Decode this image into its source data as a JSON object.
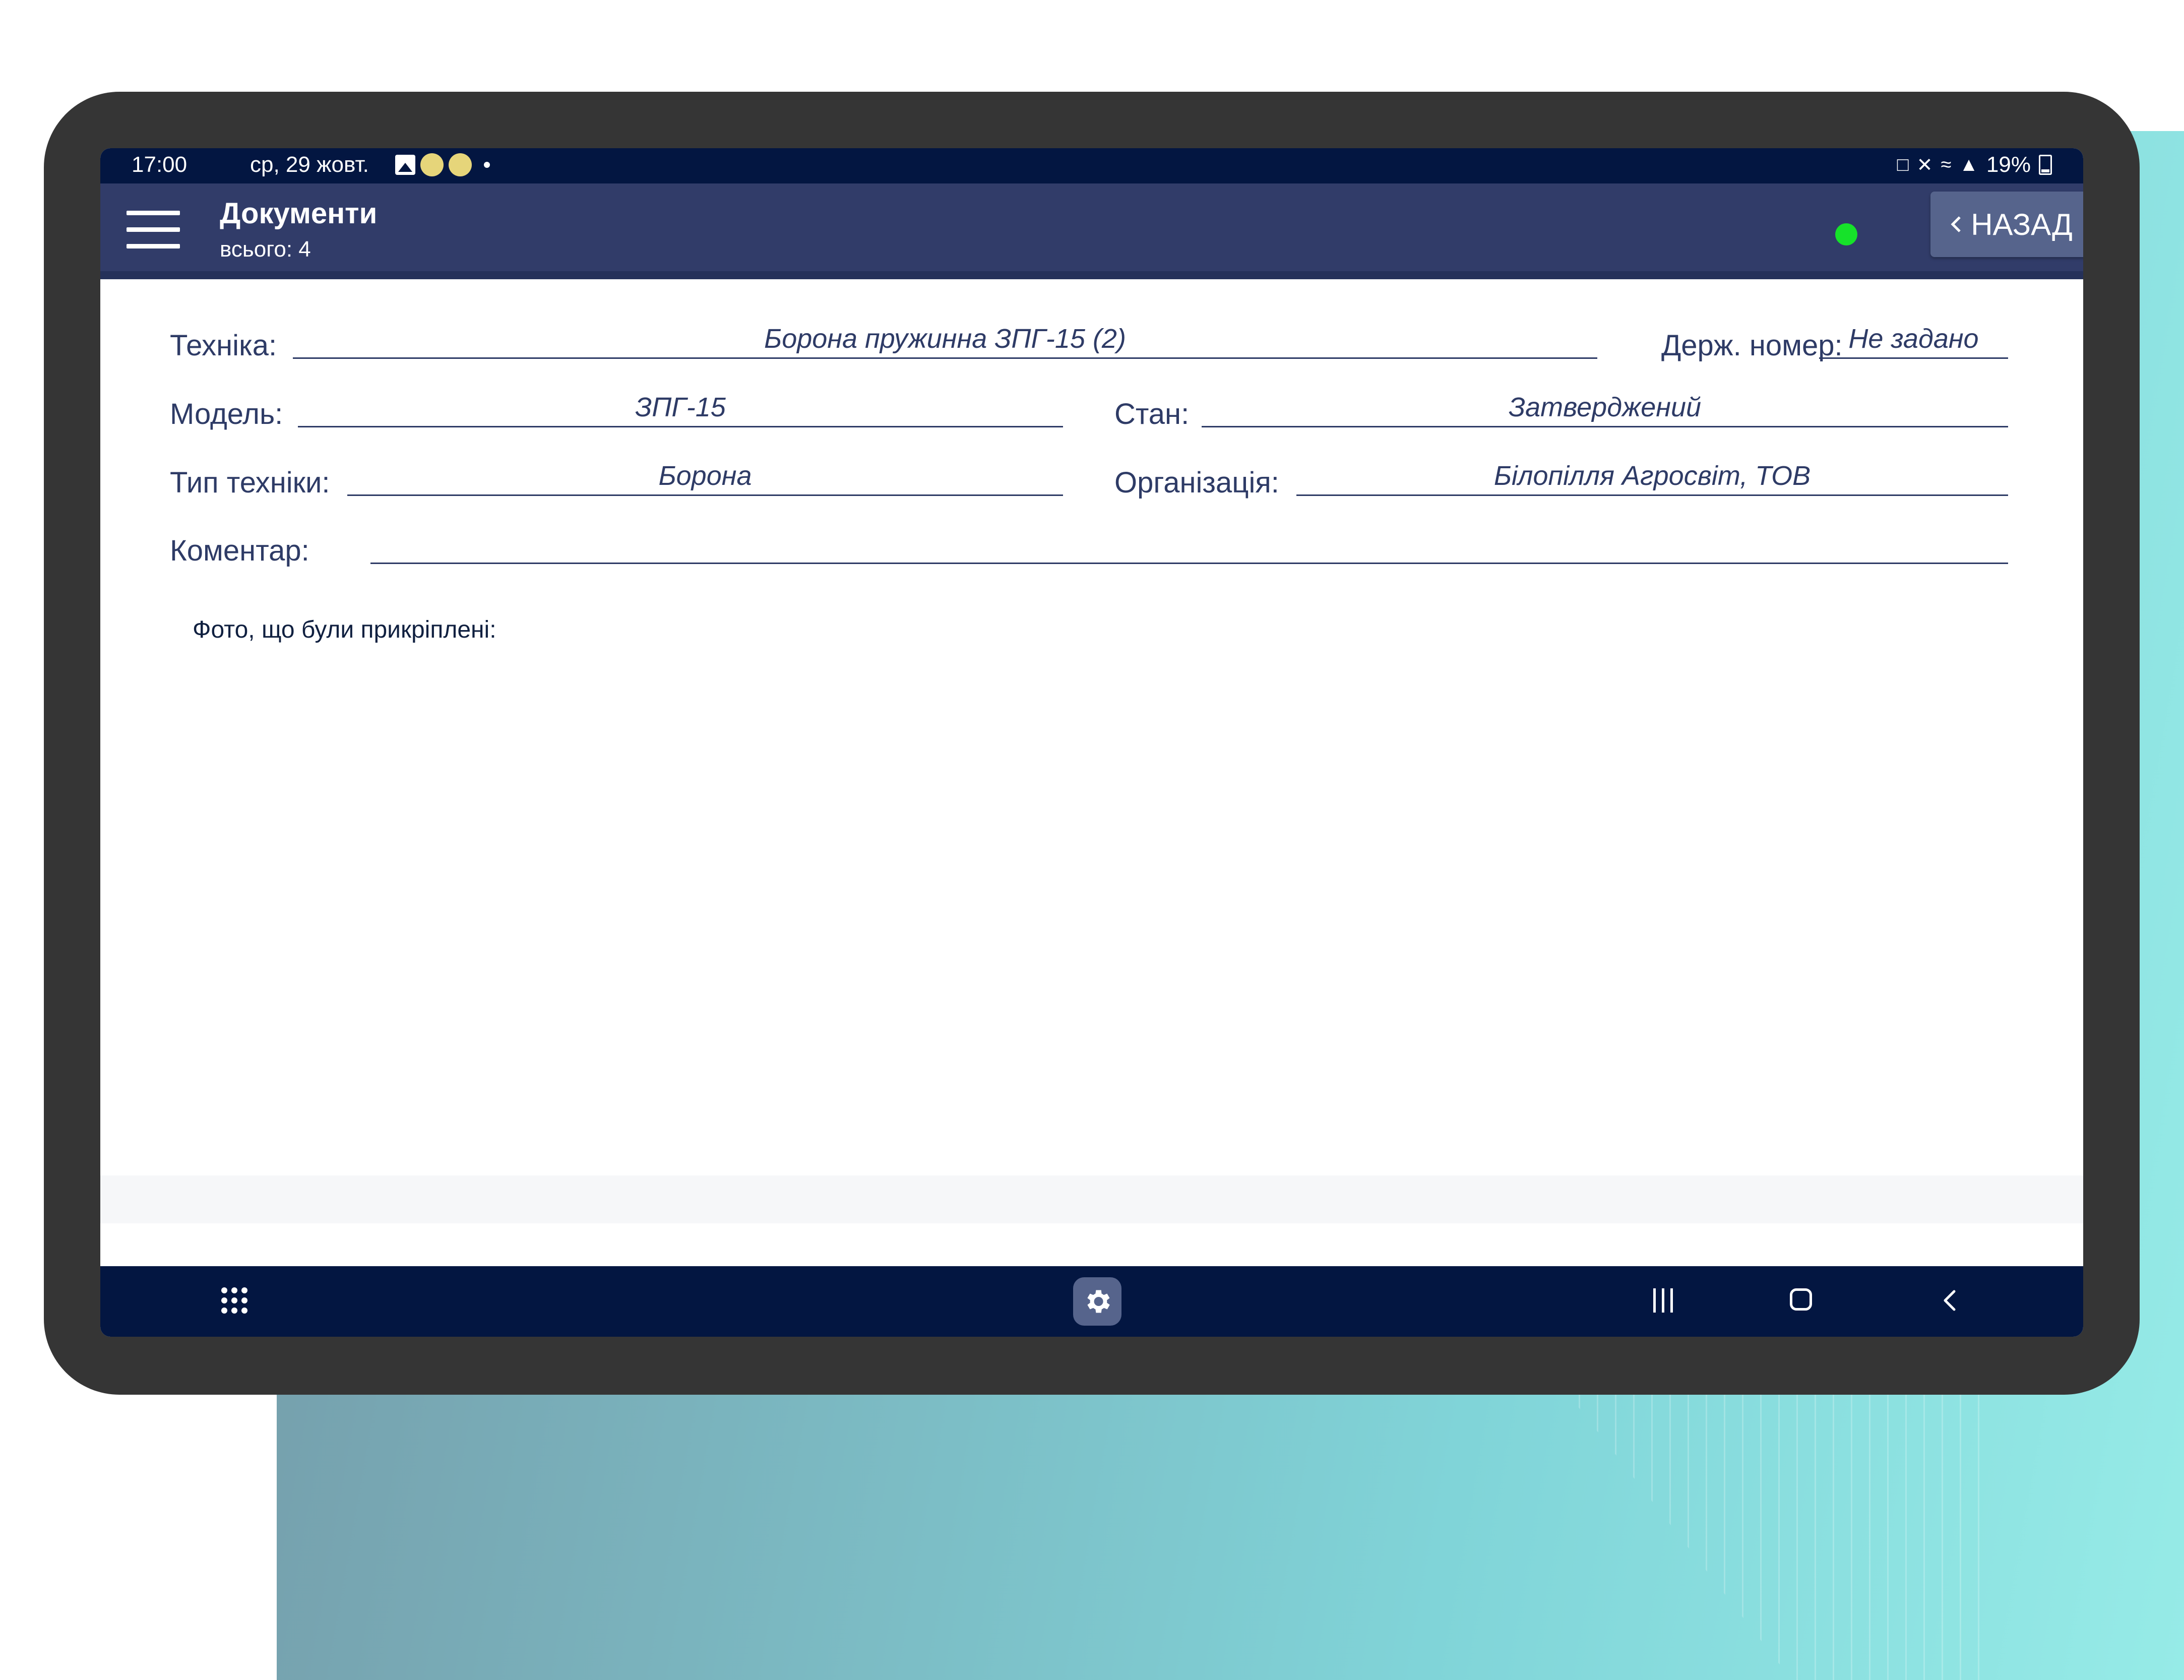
{
  "status_bar": {
    "time": "17:00",
    "date": "ср, 29 жовт.",
    "battery": "19%"
  },
  "app_bar": {
    "title": "Документи",
    "subtitle": "всього: 4",
    "back_label": "НАЗАД",
    "connection_color": "#16e22a"
  },
  "form": {
    "tekhnika_label": "Техніка:",
    "tekhnika_value": "Борона пружинна ЗПГ-15 (2)",
    "derzh_nomer_label": "Держ. номер:",
    "derzh_nomer_value": "Не задано",
    "model_label": "Модель:",
    "model_value": "ЗПГ-15",
    "stan_label": "Стан:",
    "stan_value": "Затверджений",
    "typ_label": "Тип техніки:",
    "typ_value": "Борона",
    "org_label": "Організація:",
    "org_value": "Білопілля Агросвіт, ТОВ",
    "koment_label": "Коментар:",
    "koment_value": "",
    "photos_label": "Фото, що були прикріплені:"
  },
  "colors": {
    "status_bar": "#031641",
    "app_bar": "#313c69",
    "text": "#2e3b66",
    "button": "#56648c"
  },
  "icons": {
    "menu": "hamburger-icon",
    "back": "chevron-left-icon",
    "settings": "gear-icon",
    "apps": "grid-icon",
    "recent": "recent-apps-icon",
    "home": "home-icon",
    "nav_back": "back-icon"
  }
}
